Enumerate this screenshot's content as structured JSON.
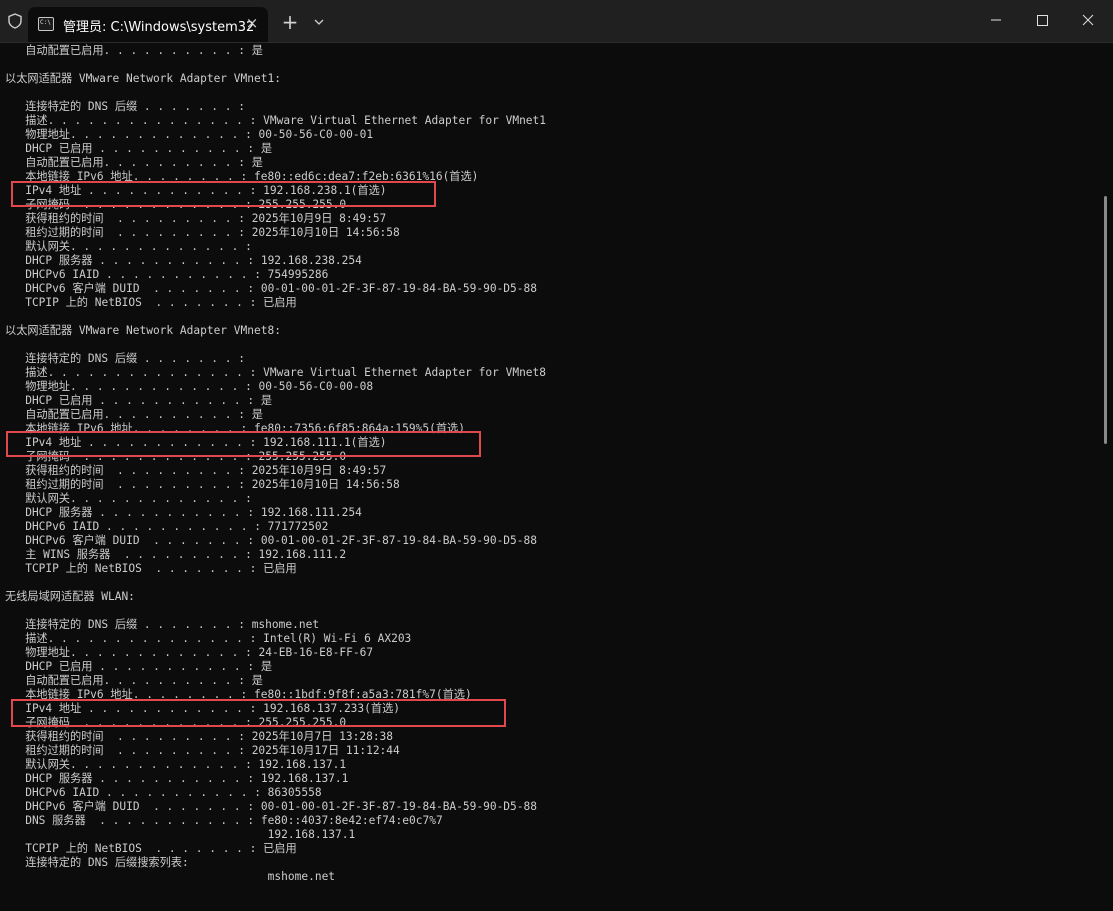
{
  "window": {
    "tab_title": "管理员: C:\\Windows\\system32",
    "tab_icon": "terminal-icon",
    "new_tab_label": "+",
    "close_tab_label": "×"
  },
  "colors": {
    "background": "#0c0c0c",
    "titlebar": "#202020",
    "text": "#cccccc",
    "highlight": "#e0484b"
  },
  "terminal_lines": [
    "   自动配置已启用. . . . . . . . . . : 是",
    "",
    "以太网适配器 VMware Network Adapter VMnet1:",
    "",
    "   连接特定的 DNS 后缀 . . . . . . . :",
    "   描述. . . . . . . . . . . . . . . : VMware Virtual Ethernet Adapter for VMnet1",
    "   物理地址. . . . . . . . . . . . . : 00-50-56-C0-00-01",
    "   DHCP 已启用 . . . . . . . . . . . : 是",
    "   自动配置已启用. . . . . . . . . . : 是",
    "   本地链接 IPv6 地址. . . . . . . . : fe80::ed6c:dea7:f2eb:6361%16(首选)",
    "   IPv4 地址 . . . . . . . . . . . . : 192.168.238.1(首选)",
    "   子网掩码  . . . . . . . . . . . . : 255.255.255.0",
    "   获得租约的时间  . . . . . . . . . : 2025年10月9日 8:49:57",
    "   租约过期的时间  . . . . . . . . . : 2025年10月10日 14:56:58",
    "   默认网关. . . . . . . . . . . . . :",
    "   DHCP 服务器 . . . . . . . . . . . : 192.168.238.254",
    "   DHCPv6 IAID . . . . . . . . . . . : 754995286",
    "   DHCPv6 客户端 DUID  . . . . . . . : 00-01-00-01-2F-3F-87-19-84-BA-59-90-D5-88",
    "   TCPIP 上的 NetBIOS  . . . . . . . : 已启用",
    "",
    "以太网适配器 VMware Network Adapter VMnet8:",
    "",
    "   连接特定的 DNS 后缀 . . . . . . . :",
    "   描述. . . . . . . . . . . . . . . : VMware Virtual Ethernet Adapter for VMnet8",
    "   物理地址. . . . . . . . . . . . . : 00-50-56-C0-00-08",
    "   DHCP 已启用 . . . . . . . . . . . : 是",
    "   自动配置已启用. . . . . . . . . . : 是",
    "   本地链接 IPv6 地址. . . . . . . . : fe80::7356:6f85:864a:159%5(首选)",
    "   IPv4 地址 . . . . . . . . . . . . : 192.168.111.1(首选)",
    "   子网掩码  . . . . . . . . . . . . : 255.255.255.0",
    "   获得租约的时间  . . . . . . . . . : 2025年10月9日 8:49:57",
    "   租约过期的时间  . . . . . . . . . : 2025年10月10日 14:56:58",
    "   默认网关. . . . . . . . . . . . . :",
    "   DHCP 服务器 . . . . . . . . . . . : 192.168.111.254",
    "   DHCPv6 IAID . . . . . . . . . . . : 771772502",
    "   DHCPv6 客户端 DUID  . . . . . . . : 00-01-00-01-2F-3F-87-19-84-BA-59-90-D5-88",
    "   主 WINS 服务器  . . . . . . . . . : 192.168.111.2",
    "   TCPIP 上的 NetBIOS  . . . . . . . : 已启用",
    "",
    "无线局域网适配器 WLAN:",
    "",
    "   连接特定的 DNS 后缀 . . . . . . . : mshome.net",
    "   描述. . . . . . . . . . . . . . . : Intel(R) Wi-Fi 6 AX203",
    "   物理地址. . . . . . . . . . . . . : 24-EB-16-E8-FF-67",
    "   DHCP 已启用 . . . . . . . . . . . : 是",
    "   自动配置已启用. . . . . . . . . . : 是",
    "   本地链接 IPv6 地址. . . . . . . . : fe80::1bdf:9f8f:a5a3:781f%7(首选)",
    "   IPv4 地址 . . . . . . . . . . . . : 192.168.137.233(首选)",
    "   子网掩码  . . . . . . . . . . . . : 255.255.255.0",
    "   获得租约的时间  . . . . . . . . . : 2025年10月7日 13:28:38",
    "   租约过期的时间  . . . . . . . . . : 2025年10月17日 11:12:44",
    "   默认网关. . . . . . . . . . . . . : 192.168.137.1",
    "   DHCP 服务器 . . . . . . . . . . . : 192.168.137.1",
    "   DHCPv6 IAID . . . . . . . . . . . : 86305558",
    "   DHCPv6 客户端 DUID  . . . . . . . : 00-01-00-01-2F-3F-87-19-84-BA-59-90-D5-88",
    "   DNS 服务器  . . . . . . . . . . . : fe80::4037:8e42:ef74:e0c7%7",
    "                                       192.168.137.1",
    "   TCPIP 上的 NetBIOS  . . . . . . . : 已启用",
    "   连接特定的 DNS 后缀搜索列表:",
    "                                       mshome.net"
  ]
}
